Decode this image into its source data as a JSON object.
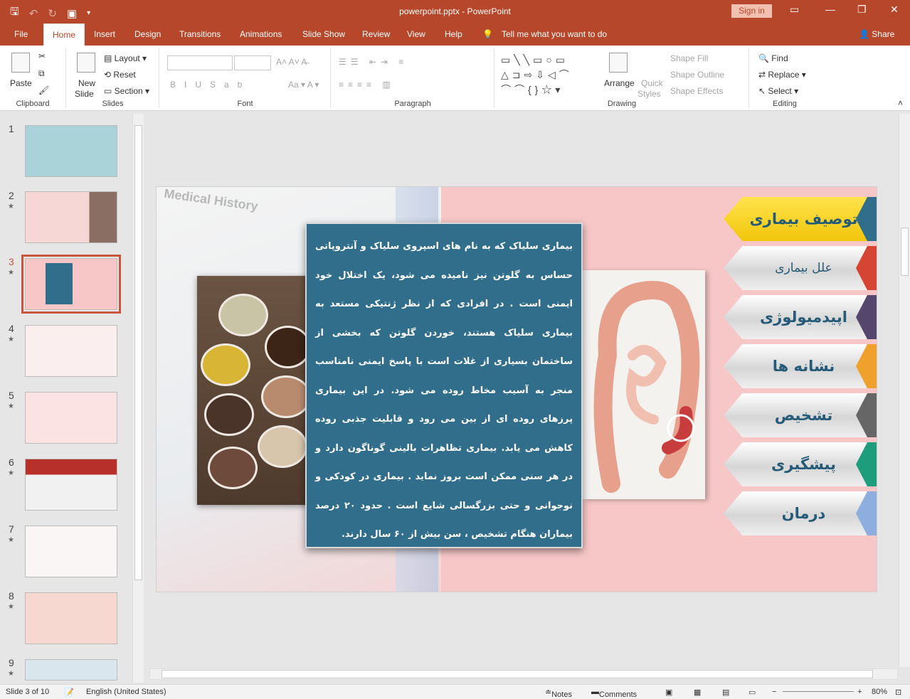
{
  "window": {
    "doc_title": "powerpoint.pptx  -  PowerPoint",
    "sign_in": "Sign in"
  },
  "tabs": [
    "File",
    "Home",
    "Insert",
    "Design",
    "Transitions",
    "Animations",
    "Slide Show",
    "Review",
    "View",
    "Help"
  ],
  "tell_me": "Tell me what you want to do",
  "share": "Share",
  "ribbon": {
    "clipboard": {
      "label": "Clipboard",
      "paste": "Paste"
    },
    "slides": {
      "label": "Slides",
      "new_slide_1": "New",
      "new_slide_2": "Slide",
      "layout": "Layout",
      "reset": "Reset",
      "section": "Section"
    },
    "font": {
      "label": "Font"
    },
    "paragraph": {
      "label": "Paragraph"
    },
    "drawing": {
      "label": "Drawing",
      "arrange": "Arrange",
      "quick_styles_1": "Quick",
      "quick_styles_2": "Styles",
      "shape_fill": "Shape Fill",
      "shape_outline": "Shape Outline",
      "shape_effects": "Shape Effects"
    },
    "editing": {
      "label": "Editing",
      "find": "Find",
      "replace": "Replace",
      "select": "Select"
    }
  },
  "thumbnails": [
    {
      "num": "1",
      "star": ""
    },
    {
      "num": "2",
      "star": "★"
    },
    {
      "num": "3",
      "star": "★"
    },
    {
      "num": "4",
      "star": "★"
    },
    {
      "num": "5",
      "star": "★"
    },
    {
      "num": "6",
      "star": "★"
    },
    {
      "num": "7",
      "star": "★"
    },
    {
      "num": "8",
      "star": "★"
    },
    {
      "num": "9",
      "star": "★"
    }
  ],
  "slide": {
    "background_text": "Medical History",
    "body": "بیماری سلیاک که به نام های اسپروی سلیاک و آنتروپاتی حساس به گلوتن نیز نامیده می شود، یک اختلال خود ایمنی است . در افرادی که از نظر ژنتیکی مستعد به بیماری سلیاک هستند، خوردن گلوتن که بخشی از ساختمان بسیاری از غلات است با پاسخ ایمنی نامناسب منجر به آسیب مخاط روده می شود. در این بیماری پرزهای روده ای از بین می رود و قابلیت جذبی روده کاهش می یابد. بیماری تظاهرات بالینی گوناگون دارد و در هر سنی ممکن است بروز نماید .  بیماری در کودکی و نوجوانی و حتی بزرگسالی شایع است . حدود ۲۰ درصد بیماران هنگام تشخیص ، سن بیش از ۶۰ سال دارند.",
    "menu": [
      {
        "label": "توصیف بیماری",
        "color": "#316e8b",
        "active": true
      },
      {
        "label": "علل بیماری",
        "color": "#d64533",
        "active": false
      },
      {
        "label": "اپیدمیولوژی",
        "color": "#55466e",
        "active": false
      },
      {
        "label": "نشانه ها",
        "color": "#f0a02c",
        "active": false
      },
      {
        "label": "تشخیص",
        "color": "#666666",
        "active": false
      },
      {
        "label": "پیشگیری",
        "color": "#1d9d7c",
        "active": false
      },
      {
        "label": "درمان",
        "color": "#8eaee0",
        "active": false
      }
    ]
  },
  "status": {
    "slide_of": "Slide 3 of 10",
    "language": "English (United States)",
    "notes": "Notes",
    "comments": "Comments",
    "zoom": "80%"
  }
}
